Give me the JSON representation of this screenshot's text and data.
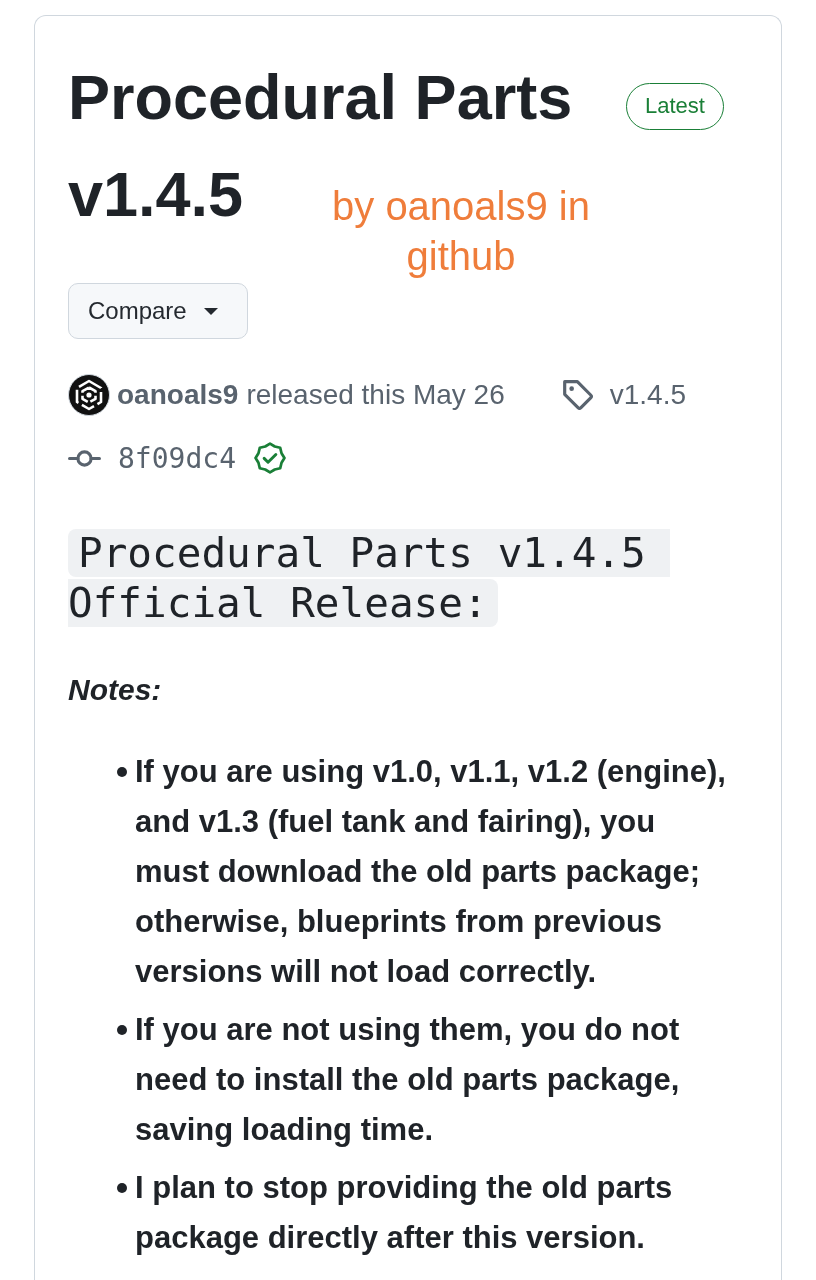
{
  "release": {
    "title_lines": [
      "Procedural Parts",
      "v1.4.5"
    ],
    "badge": "Latest",
    "compare_button": "Compare",
    "author": "oanoals9",
    "released": "released this May 26",
    "tag": "v1.4.5",
    "commit": "8f09dc4",
    "verified": true
  },
  "annotation": "by oanoals9 in github",
  "body": {
    "code_heading": "Procedural Parts v1.4.5 Official Release:",
    "notes_label": "Notes:",
    "notes": [
      "If you are using v1.0, v1.1, v1.2 (engine), and v1.3 (fuel tank and fairing), you must download the old parts package; otherwise, blueprints from previous versions will not load correctly.",
      "If you are not using them, you do not need to install the old parts package, saving loading time.",
      "I plan to stop providing the old parts package directly after this version."
    ]
  }
}
